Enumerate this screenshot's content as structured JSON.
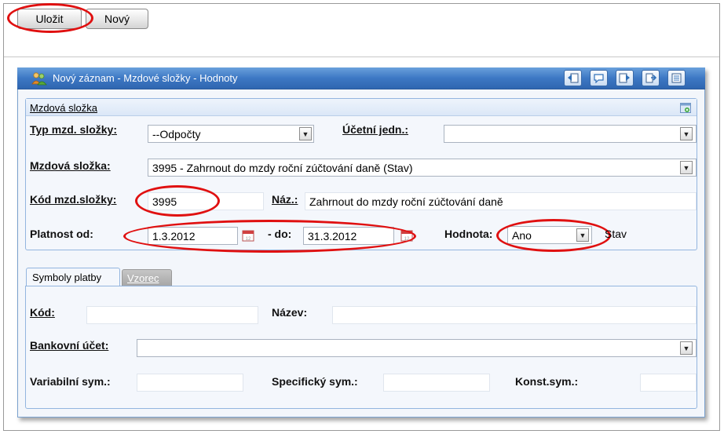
{
  "toolbar": {
    "save_label": "Uložit",
    "new_label": "Nový"
  },
  "window": {
    "title": "Nový záznam - Mzdové složky - Hodnoty",
    "title_icon": "users-icon",
    "toolbar_icons": [
      "back-icon",
      "comment-icon",
      "forward-icon",
      "export-icon",
      "list-icon"
    ]
  },
  "mzdova_slozka": {
    "header": "Mzdová složka",
    "typ_label": "Typ mzd. složky:",
    "typ_value": "--Odpočty",
    "ucetni_label": "Účetní jedn.:",
    "ucetni_value": "",
    "mzdova_label": "Mzdová složka:",
    "mzdova_value": "3995 - Zahrnout do mzdy roční zúčtování daně (Stav)",
    "kod_label": "Kód mzd.složky:",
    "kod_value": "3995",
    "naz_label": "Náz.:",
    "naz_value": "Zahrnout do mzdy roční zúčtování daně",
    "platnost_label": "Platnost od:",
    "platnost_od": "1.3.2012",
    "do_label": "- do:",
    "platnost_do": "31.3.2012",
    "hodnota_label": "Hodnota:",
    "hodnota_value": "Ano",
    "stav_label": "Stav"
  },
  "tabs": {
    "symboly": "Symboly platby",
    "vzorec": "Vzorec"
  },
  "symboly": {
    "kod_label": "Kód:",
    "kod_value": "",
    "nazev_label": "Název:",
    "nazev_value": "",
    "bank_label": "Bankovní účet:",
    "bank_value": "",
    "var_label": "Variabilní sym.:",
    "var_value": "",
    "spec_label": "Specifický sym.:",
    "spec_value": "",
    "konst_label": "Konst.sym.:",
    "konst_value": ""
  },
  "colors": {
    "titlebar": "#3d78c4",
    "highlight": "#e01010",
    "panel_border": "#93b5df"
  }
}
